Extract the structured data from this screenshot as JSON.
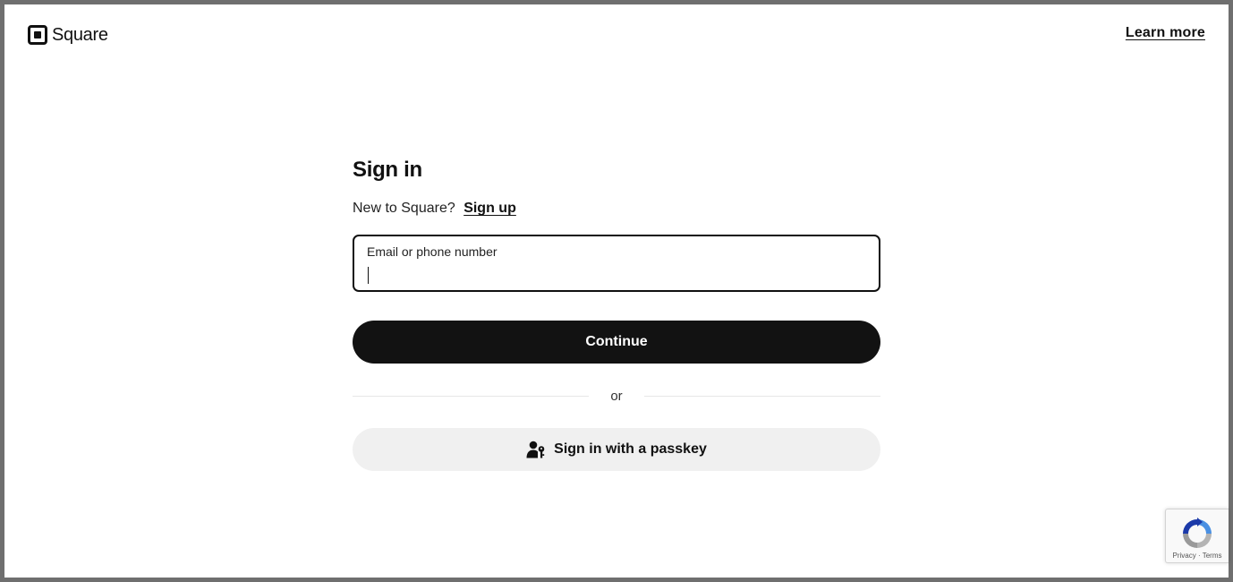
{
  "header": {
    "logo_text": "Square",
    "learn_more_label": "Learn more"
  },
  "signin": {
    "title": "Sign in",
    "new_prompt": "New to Square?",
    "signup_label": "Sign up",
    "field_label": "Email or phone number",
    "field_value": "",
    "continue_label": "Continue",
    "divider_text": "or",
    "passkey_label": "Sign in with a passkey"
  },
  "recaptcha": {
    "privacy_label": "Privacy",
    "separator": "·",
    "terms_label": "Terms"
  },
  "icons": {
    "logo": "square-logo-icon",
    "passkey": "user-key-icon",
    "recaptcha": "recaptcha-icon"
  },
  "colors": {
    "primary_button": "#121212",
    "secondary_button": "#f0f0f0",
    "text": "#111111",
    "page_border": "#6f6f6f"
  }
}
